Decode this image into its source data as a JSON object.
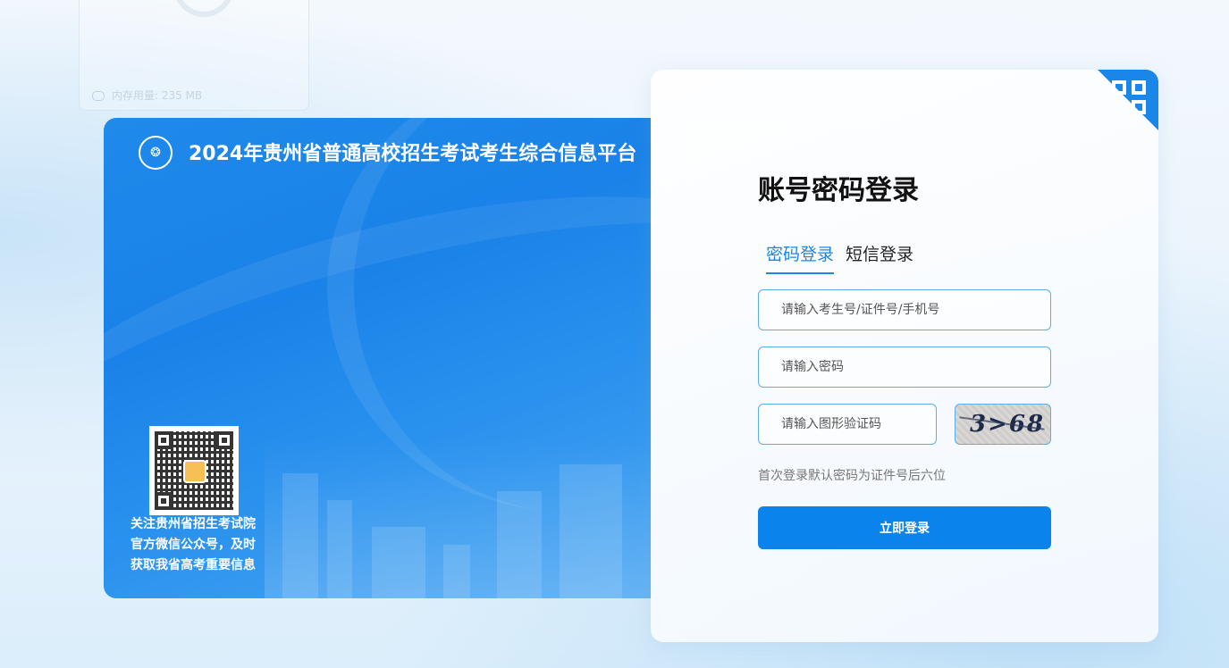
{
  "background": {
    "ghost_text": "内存用量: 235 MB"
  },
  "banner": {
    "logo_icon": "guizhou-exam-logo",
    "title": "2024年贵州省普通高校招生考试考生综合信息平台",
    "qr_caption_lines": [
      "关注贵州省招生考试院",
      "官方微信公众号，及时",
      "获取我省高考重要信息"
    ]
  },
  "login": {
    "title": "账号密码登录",
    "tabs": [
      {
        "label": "密码登录",
        "active": true
      },
      {
        "label": "短信登录",
        "active": false
      }
    ],
    "id_placeholder": "请输入考生号/证件号/手机号",
    "password_placeholder": "请输入密码",
    "captcha_placeholder": "请输入图形验证码",
    "captcha_text": "3>68",
    "hint": "首次登录默认密码为证件号后六位",
    "submit_label": "立即登录"
  },
  "colors": {
    "accent": "#1a86e8",
    "button": "#0a84ec",
    "banner": "#1a82e8"
  }
}
